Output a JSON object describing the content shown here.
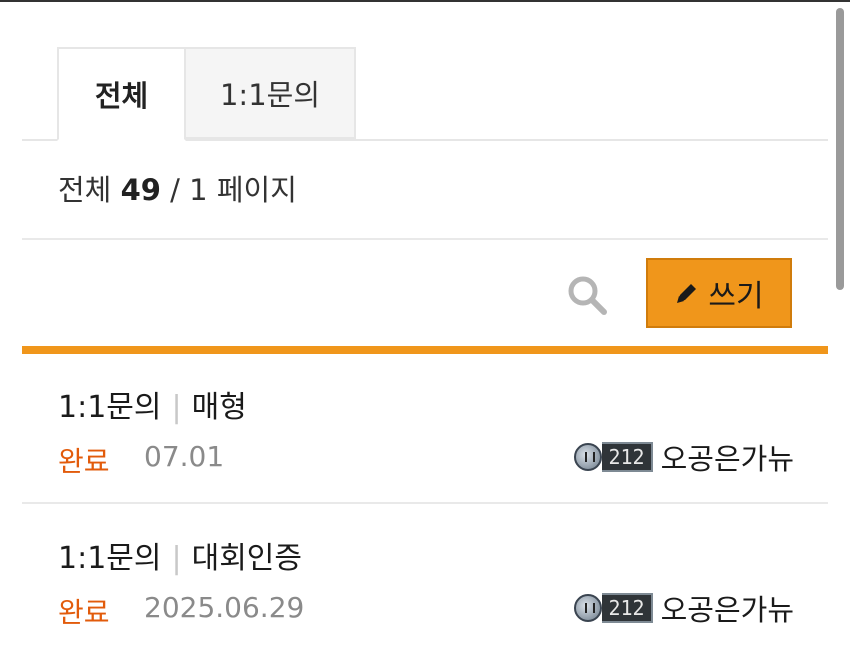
{
  "tabs": [
    {
      "label": "전체",
      "active": true
    },
    {
      "label": "1:1문의",
      "active": false
    }
  ],
  "summary": {
    "prefix": "전체",
    "count": "49",
    "pages": "/ 1 페이지"
  },
  "toolbar": {
    "write_label": "쓰기",
    "search_icon": "search-icon",
    "pencil_icon": "pencil-icon"
  },
  "colors": {
    "accent": "#f0961b",
    "status": "#e25b0b"
  },
  "posts": [
    {
      "category": "1:1문의",
      "title": "매형",
      "status": "완료",
      "date": "07.01",
      "level": "212",
      "author": "오공은가뉴"
    },
    {
      "category": "1:1문의",
      "title": "대회인증",
      "status": "완료",
      "date": "2025.06.29",
      "level": "212",
      "author": "오공은가뉴"
    }
  ]
}
